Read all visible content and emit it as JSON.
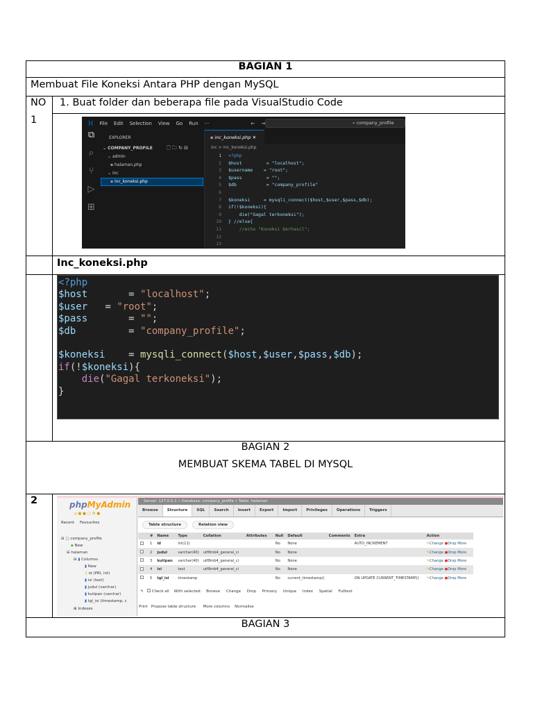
{
  "bagian1": {
    "title": "BAGIAN 1",
    "subtitle": "Membuat File Koneksi Antara PHP dengan MySQL",
    "no_label": "NO",
    "no_value": "1",
    "step": "1.  Buat folder dan beberapa file pada VisualStudio Code",
    "file_label": "Inc_koneksi.php"
  },
  "vscode": {
    "menu": [
      "File",
      "Edit",
      "Selection",
      "View",
      "Go",
      "Run",
      "···"
    ],
    "search": "company_profile",
    "explorer": "EXPLORER",
    "project": "COMPANY_PROFILE",
    "tree": [
      "admin",
      "halaman.php",
      "inc",
      "inc_koneksi.php"
    ],
    "tab": "inc_koneksi.php",
    "breadcrumb": "inc  >  inc_koneksi.php",
    "lines": [
      "<?php",
      "$host         = \"localhost\";",
      "$username    = \"root\";",
      "$pass         = \"\";",
      "$db           = \"company_profile\"",
      "",
      "$koneksi     = mysqli_connect($host,$user,$pass,$db);",
      "if(!$koneksi){",
      "    die(\"Gagal terkoneksi\");",
      "} //else{",
      "    //echo \"Koneksi berhasil\";",
      "",
      ""
    ]
  },
  "code": {
    "lines": [
      [
        [
          "p",
          "<?php"
        ]
      ],
      [
        [
          "v",
          "$host"
        ],
        [
          "d",
          "       = "
        ],
        [
          "s",
          "\"localhost\""
        ],
        [
          "d",
          ";"
        ]
      ],
      [
        [
          "v",
          "$user"
        ],
        [
          "d",
          "   = "
        ],
        [
          "s",
          "\"root\""
        ],
        [
          "d",
          ";"
        ]
      ],
      [
        [
          "v",
          "$pass"
        ],
        [
          "d",
          "       = "
        ],
        [
          "s",
          "\"\""
        ],
        [
          "d",
          ";"
        ]
      ],
      [
        [
          "v",
          "$db"
        ],
        [
          "d",
          "         = "
        ],
        [
          "s",
          "\"company_profile\""
        ],
        [
          "d",
          ";"
        ]
      ],
      [],
      [
        [
          "v",
          "$koneksi"
        ],
        [
          "d",
          "    = "
        ],
        [
          "f",
          "mysqli_connect"
        ],
        [
          "d",
          "("
        ],
        [
          "v",
          "$host"
        ],
        [
          "d",
          ","
        ],
        [
          "v",
          "$user"
        ],
        [
          "d",
          ","
        ],
        [
          "v",
          "$pass"
        ],
        [
          "d",
          ","
        ],
        [
          "v",
          "$db"
        ],
        [
          "d",
          ");"
        ]
      ],
      [
        [
          "k",
          "if"
        ],
        [
          "d",
          "(!"
        ],
        [
          "v",
          "$koneksi"
        ],
        [
          "d",
          "){"
        ]
      ],
      [
        [
          "d",
          "    "
        ],
        [
          "k",
          "die"
        ],
        [
          "d",
          "("
        ],
        [
          "s",
          "\"Gagal terkoneksi\""
        ],
        [
          "d",
          ");"
        ]
      ],
      [
        [
          "d",
          "}"
        ]
      ]
    ]
  },
  "bagian2": {
    "title": "BAGIAN 2",
    "subtitle": "MEMBUAT SKEMA TABEL DI MYSQL",
    "no_value": "2"
  },
  "pma": {
    "logo_a": "php",
    "logo_b": "MyAdmin",
    "nav_tabs": [
      "Recent",
      "Favourites"
    ],
    "tree": [
      "company_profile",
      "New",
      "halaman",
      "Columns",
      "New",
      "id (PRI, int)",
      "isi (text)",
      "judul (varchar)",
      "kutipan (varchar)",
      "tgl_isi (timestamp, c",
      "Indexes"
    ],
    "breadcrumb": "Server: 127.0.0.1  »  Database: company_profile  »  Table: halaman",
    "tabs": [
      "Browse",
      "Structure",
      "SQL",
      "Search",
      "Insert",
      "Export",
      "Import",
      "Privileges",
      "Operations",
      "Triggers"
    ],
    "subtabs": [
      "Table structure",
      "Relation view"
    ],
    "headers": [
      "",
      "#",
      "Name",
      "Type",
      "Collation",
      "Attributes",
      "Null",
      "Default",
      "Comments",
      "Extra",
      "Action"
    ],
    "rows": [
      [
        "1",
        "id",
        "int(11)",
        "",
        "",
        "No",
        "None",
        "",
        "AUTO_INCREMENT"
      ],
      [
        "2",
        "judul",
        "varchar(40)",
        "utf8mb4_general_ci",
        "",
        "No",
        "None",
        "",
        ""
      ],
      [
        "3",
        "kutipan",
        "varchar(40)",
        "utf8mb4_general_ci",
        "",
        "No",
        "None",
        "",
        ""
      ],
      [
        "4",
        "isi",
        "text",
        "utf8mb4_general_ci",
        "",
        "No",
        "None",
        "",
        ""
      ],
      [
        "5",
        "tgl_isi",
        "timestamp",
        "",
        "",
        "No",
        "current_timestamp()",
        "",
        "ON UPDATE CURRENT_TIMESTAMP()"
      ]
    ],
    "actions": [
      "Change",
      "Drop",
      "More"
    ],
    "bulk": [
      "Check all",
      "With selected:",
      "Browse",
      "Change",
      "Drop",
      "Primary",
      "Unique",
      "Index",
      "Spatial",
      "Fulltext"
    ],
    "footer": [
      "Print",
      "Propose table structure",
      "More columns",
      "Normalise"
    ]
  },
  "bagian3": {
    "title": "BAGIAN 3"
  }
}
